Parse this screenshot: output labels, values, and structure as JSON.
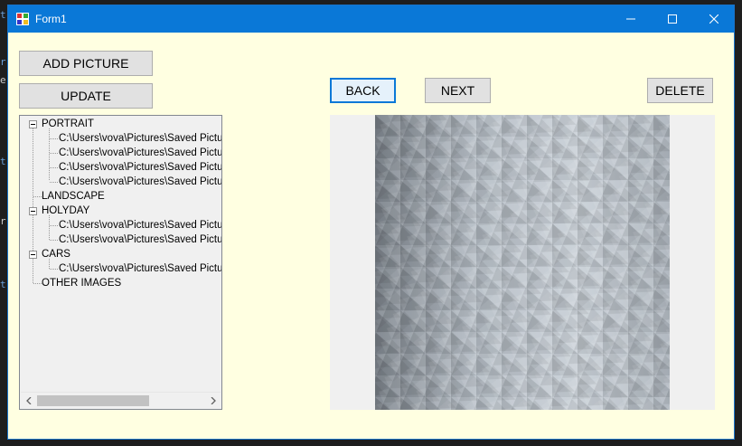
{
  "window": {
    "title": "Form1"
  },
  "background_glyphs": [
    "t",
    "r",
    "e",
    "t",
    "r",
    "t"
  ],
  "buttons": {
    "add_picture": "ADD PICTURE",
    "update": "UPDATE",
    "back": "BACK",
    "next": "NEXT",
    "delete": "DELETE"
  },
  "tree": {
    "nodes": [
      {
        "label": "PORTRAIT",
        "expanded": true,
        "children": [
          "C:\\Users\\vova\\Pictures\\Saved Pictur",
          "C:\\Users\\vova\\Pictures\\Saved Pictur",
          "C:\\Users\\vova\\Pictures\\Saved Pictur",
          "C:\\Users\\vova\\Pictures\\Saved Pictur"
        ]
      },
      {
        "label": "LANDSCAPE",
        "expanded": false,
        "children": []
      },
      {
        "label": "HOLYDAY",
        "expanded": true,
        "children": [
          "C:\\Users\\vova\\Pictures\\Saved Pictur",
          "C:\\Users\\vova\\Pictures\\Saved Pictur"
        ]
      },
      {
        "label": "CARS",
        "expanded": true,
        "children": [
          "C:\\Users\\vova\\Pictures\\Saved Pictur"
        ]
      },
      {
        "label": "OTHER IMAGES",
        "expanded": false,
        "children": []
      }
    ]
  },
  "picture": {
    "description_icon": "low-poly-texture-image"
  },
  "colors": {
    "titlebar": "#0a78d7",
    "form_background": "#ffffe1",
    "button_face": "#e1e1e1",
    "focus_border": "#0a78d7"
  }
}
